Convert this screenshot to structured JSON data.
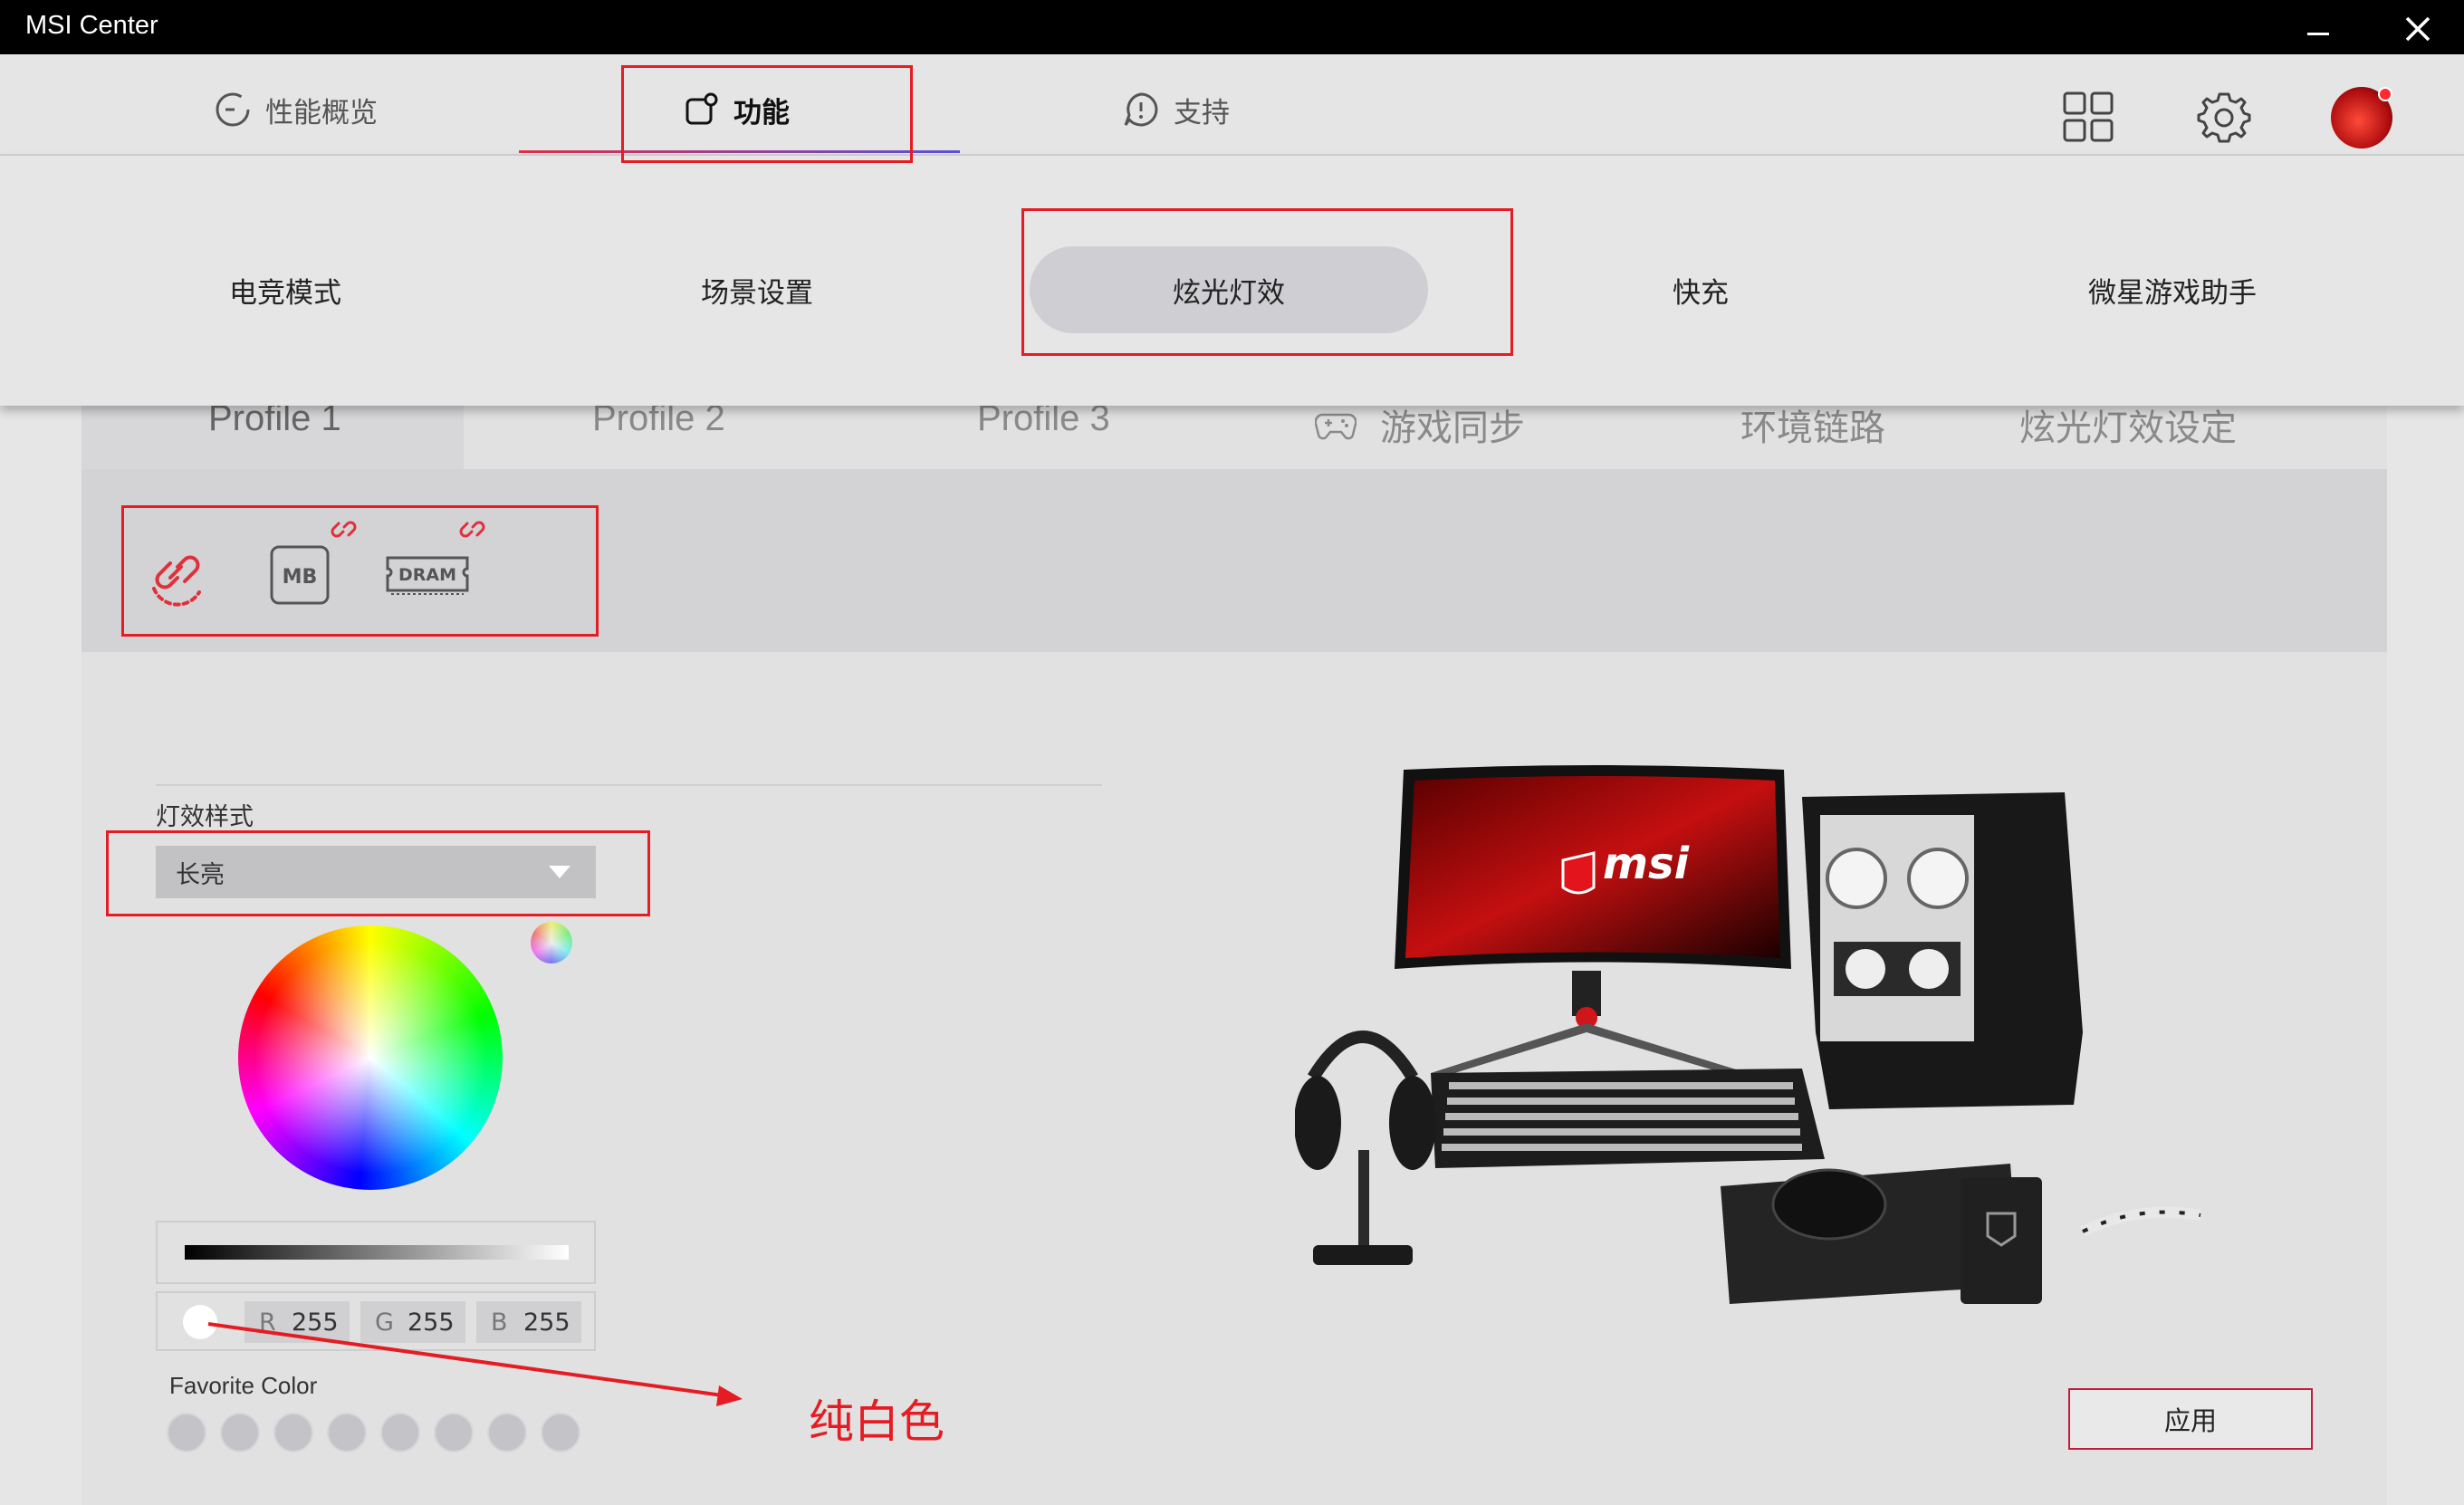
{
  "window": {
    "title": "MSI Center"
  },
  "nav": {
    "tabs": [
      {
        "label": "性能概览",
        "icon": "gauge-icon"
      },
      {
        "label": "功能",
        "icon": "feature-icon",
        "active": true
      },
      {
        "label": "支持",
        "icon": "chat-icon"
      }
    ],
    "right_icons": [
      "grid-icon",
      "settings-gear-icon",
      "user-avatar"
    ]
  },
  "submenu": {
    "items": [
      {
        "label": "电竞模式"
      },
      {
        "label": "场景设置"
      },
      {
        "label": "炫光灯效",
        "active": true
      },
      {
        "label": "快充"
      },
      {
        "label": "微星游戏助手"
      }
    ]
  },
  "profile_tabs": [
    {
      "label": "Profile 1",
      "active": true
    },
    {
      "label": "Profile 2"
    },
    {
      "label": "Profile 3"
    },
    {
      "label": "游戏同步",
      "icon": "gamepad-icon"
    },
    {
      "label": "环境链路"
    },
    {
      "label": "炫光灯效设定"
    }
  ],
  "devices": {
    "items": [
      {
        "name": "sync-link-icon"
      },
      {
        "label": "MB",
        "name": "motherboard-icon"
      },
      {
        "label": "DRAM",
        "name": "dram-icon"
      }
    ]
  },
  "effect": {
    "label": "灯效样式",
    "selected": "长亮"
  },
  "color": {
    "r_label": "R",
    "r": "255",
    "g_label": "G",
    "g": "255",
    "b_label": "B",
    "b": "255",
    "swatch": "#ffffff"
  },
  "favorite": {
    "label": "Favorite Color",
    "count": 8
  },
  "annotation": {
    "text": "纯白色"
  },
  "apply_label": "应用",
  "colors": {
    "accent_red": "#e51c23",
    "bg": "#e6e6e6"
  }
}
